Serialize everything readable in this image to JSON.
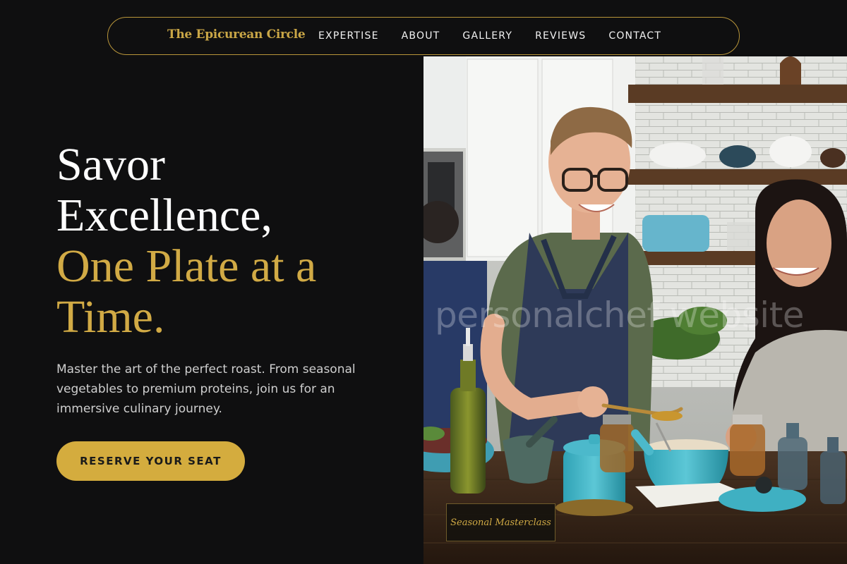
{
  "nav": {
    "brand": "The Epicurean Circle",
    "links": [
      "EXPERTISE",
      "ABOUT",
      "GALLERY",
      "REVIEWS",
      "CONTACT"
    ]
  },
  "hero": {
    "headline_white": [
      "Savor",
      "Excellence,"
    ],
    "headline_gold": [
      "One Plate at a",
      "Time."
    ],
    "lead": "Master the art of the perfect roast. From seasonal vegetables to premium proteins, join us for an immersive culinary journey.",
    "cta_label": "RESERVE YOUR SEAT"
  },
  "photo": {
    "watermark": "personalchef website",
    "caption": "Seasonal Masterclass"
  },
  "colors": {
    "background": "#0f0f10",
    "accent_gold": "#d1aa45",
    "button_gold": "#d4ac3e"
  }
}
